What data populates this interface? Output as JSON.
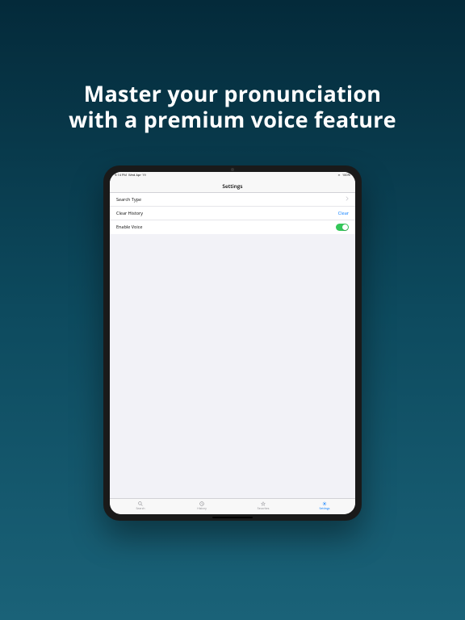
{
  "headline": {
    "line1": "Master your pronunciation",
    "line2": "with a premium voice feature"
  },
  "status": {
    "time": "9:14 PM",
    "date": "Wed Apr 19",
    "battery": "100%"
  },
  "nav": {
    "title": "Settings"
  },
  "settings": {
    "rows": [
      {
        "label": "Search Type",
        "type": "disclosure"
      },
      {
        "label": "Clear History",
        "type": "action",
        "action": "Clear"
      },
      {
        "label": "Enable Voice",
        "type": "toggle",
        "on": true
      }
    ]
  },
  "tabs": [
    {
      "label": "Search",
      "active": false
    },
    {
      "label": "History",
      "active": false
    },
    {
      "label": "Favorites",
      "active": false
    },
    {
      "label": "Settings",
      "active": true
    }
  ]
}
